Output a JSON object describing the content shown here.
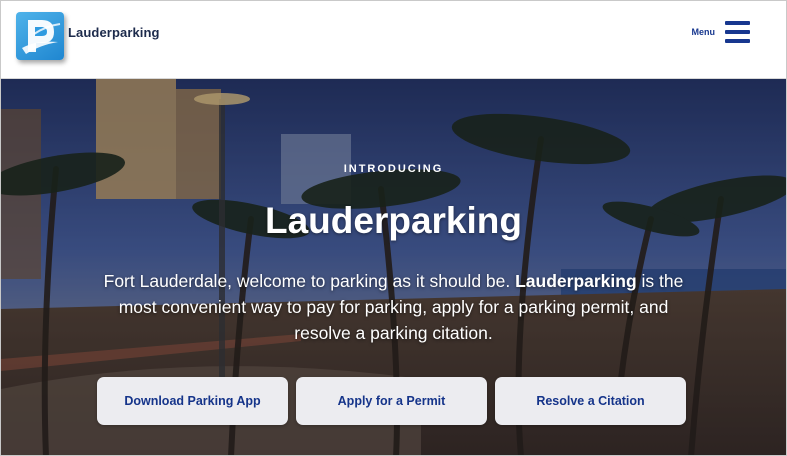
{
  "header": {
    "brand": "Lauderparking",
    "menu_label": "Menu"
  },
  "hero": {
    "eyebrow": "INTRODUCING",
    "title": "Lauderparking",
    "text_part1": "Fort Lauderdale, welcome to parking as it should be. ",
    "text_bold": "Lauderparking",
    "text_part2": " is the most convenient way to pay for parking, apply for a parking permit, and resolve a parking citation.",
    "buttons": [
      {
        "label": "Download Parking App"
      },
      {
        "label": "Apply for a Permit"
      },
      {
        "label": "Resolve a Citation"
      }
    ]
  },
  "colors": {
    "brand_navy": "#17378f",
    "button_bg": "#ececf0",
    "logo_blue": "#2e9be0"
  },
  "icons": {
    "logo": "lauderparking-logo-icon",
    "menu": "hamburger-menu-icon"
  }
}
